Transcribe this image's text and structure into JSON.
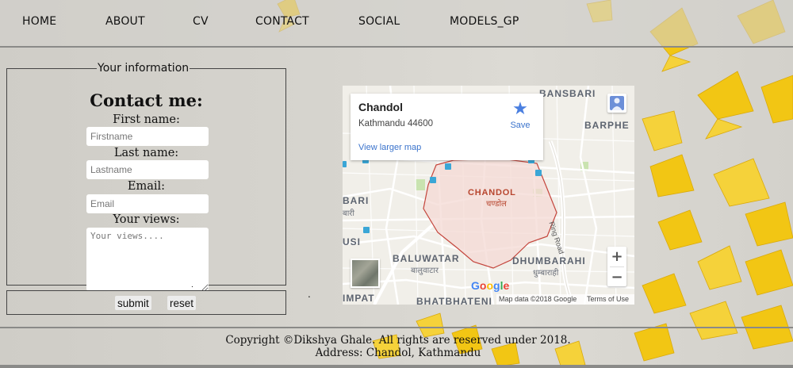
{
  "nav": {
    "items": [
      {
        "label": "HOME"
      },
      {
        "label": "ABOUT"
      },
      {
        "label": "CV"
      },
      {
        "label": "CONTACT"
      },
      {
        "label": "SOCIAL"
      },
      {
        "label": "MODELS_GP"
      }
    ]
  },
  "form": {
    "legend": "Your information",
    "title": "Contact me:",
    "first_name_label": "First name:",
    "first_name_placeholder": "Firstname",
    "last_name_label": "Last name:",
    "last_name_placeholder": "Lastname",
    "email_label": "Email:",
    "email_placeholder": "Email",
    "views_label": "Your views:",
    "views_placeholder": "Your views....",
    "submit_label": "submit",
    "reset_label": "reset"
  },
  "map": {
    "place_name": "Chandol",
    "place_address": "Kathmandu 44600",
    "save_label": "Save",
    "view_larger_label": "View larger map",
    "labels": {
      "bansbari": "BANSBARI",
      "barphe": "BARPHE",
      "bari": "BARI",
      "bari_dev": "बारी",
      "chandol": "CHANDOL",
      "chandol_dev": "चण्डोल",
      "usi": "USI",
      "baluwatar": "BALUWATAR",
      "baluwatar_dev": "बालुवाटार",
      "dhumbarahi": "DHUMBARAHI",
      "dhumbarahi_dev": "धुम्बाराही",
      "impat": "IMPAT",
      "bhatbhateni": "BHATBHATENI",
      "ring_road": "Ring Road"
    },
    "zoom_in": "+",
    "zoom_out": "−",
    "attribution": "Map data ©2018 Google",
    "terms": "Terms of Use",
    "logo": "Google",
    "colors": {
      "area_outline": "#c4453c",
      "area_fill": "#f4d9d4",
      "star": "#4a7fe0",
      "link": "#3a73cc"
    }
  },
  "footer": {
    "copyright": "Copyright ©Dikshya Ghale. All rights are reserved under 2018.",
    "address": "Address: Chandol, Kathmandu"
  }
}
